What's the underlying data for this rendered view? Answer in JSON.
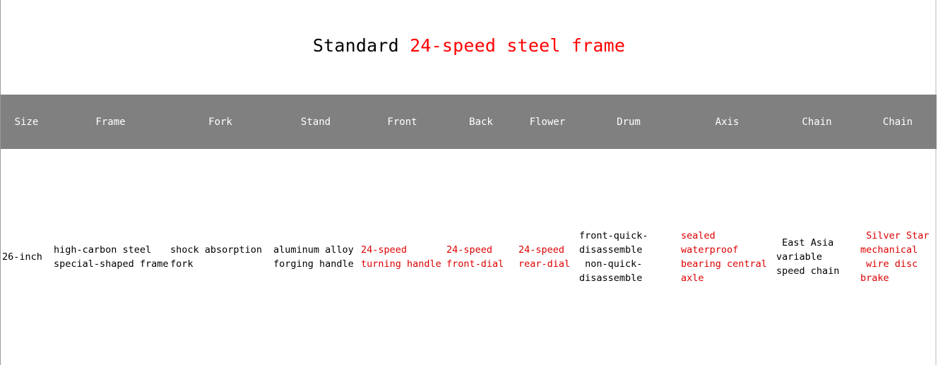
{
  "title": {
    "prefix": "Standard",
    "accent": "24-speed steel frame",
    "accent_color": "#ff0000"
  },
  "table": {
    "header_bg": "#808080",
    "body_red": "#dd0000",
    "headers": [
      "Size",
      "Frame",
      "Fork",
      "Stand",
      "Front",
      "Back",
      "Flower",
      "Drum",
      "Axis",
      "Chain",
      "Chain"
    ],
    "row": [
      {
        "lines": [
          "26-inch"
        ],
        "red": false
      },
      {
        "lines": [
          "high-carbon steel",
          "special-shaped frame"
        ],
        "red": false
      },
      {
        "lines": [
          "shock absorption",
          "fork"
        ],
        "red": false
      },
      {
        "lines": [
          "aluminum alloy",
          "forging handle"
        ],
        "red": false
      },
      {
        "lines": [
          "24-speed",
          "turning handle"
        ],
        "red": true
      },
      {
        "lines": [
          "24-speed",
          "front-dial"
        ],
        "red": true
      },
      {
        "lines": [
          "24-speed",
          "rear-dial"
        ],
        "red": true
      },
      {
        "lines": [
          "front-quick-",
          "disassemble",
          " non-quick-",
          "disassemble"
        ],
        "red": false
      },
      {
        "lines": [
          "sealed",
          "waterproof",
          "bearing central",
          "axle"
        ],
        "red": true
      },
      {
        "lines": [
          " East Asia",
          "variable",
          "speed chain"
        ],
        "red": false
      },
      {
        "lines": [
          " Silver Star",
          "mechanical",
          " wire disc",
          "brake"
        ],
        "red": true
      }
    ]
  }
}
